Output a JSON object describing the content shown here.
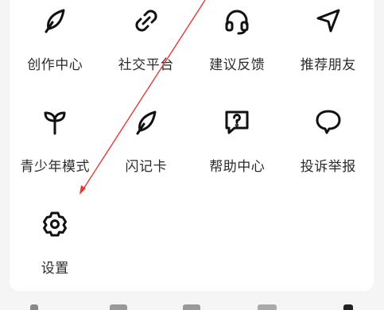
{
  "menu": {
    "items": [
      {
        "label": "创作中心",
        "icon": "feather-icon"
      },
      {
        "label": "社交平台",
        "icon": "link-icon"
      },
      {
        "label": "建议反馈",
        "icon": "headset-icon"
      },
      {
        "label": "推荐朋友",
        "icon": "send-arrow-icon"
      },
      {
        "label": "青少年模式",
        "icon": "sprout-icon"
      },
      {
        "label": "闪记卡",
        "icon": "feather-icon"
      },
      {
        "label": "帮助中心",
        "icon": "help-question-icon"
      },
      {
        "label": "投诉举报",
        "icon": "report-bubble-icon"
      },
      {
        "label": "设置",
        "icon": "settings-gear-icon"
      }
    ]
  },
  "colors": {
    "icon": "#111111",
    "text": "#2b2b2b",
    "annotation_arrow": "#e53935",
    "panel": "#ffffff",
    "background": "#f5f5f5"
  }
}
